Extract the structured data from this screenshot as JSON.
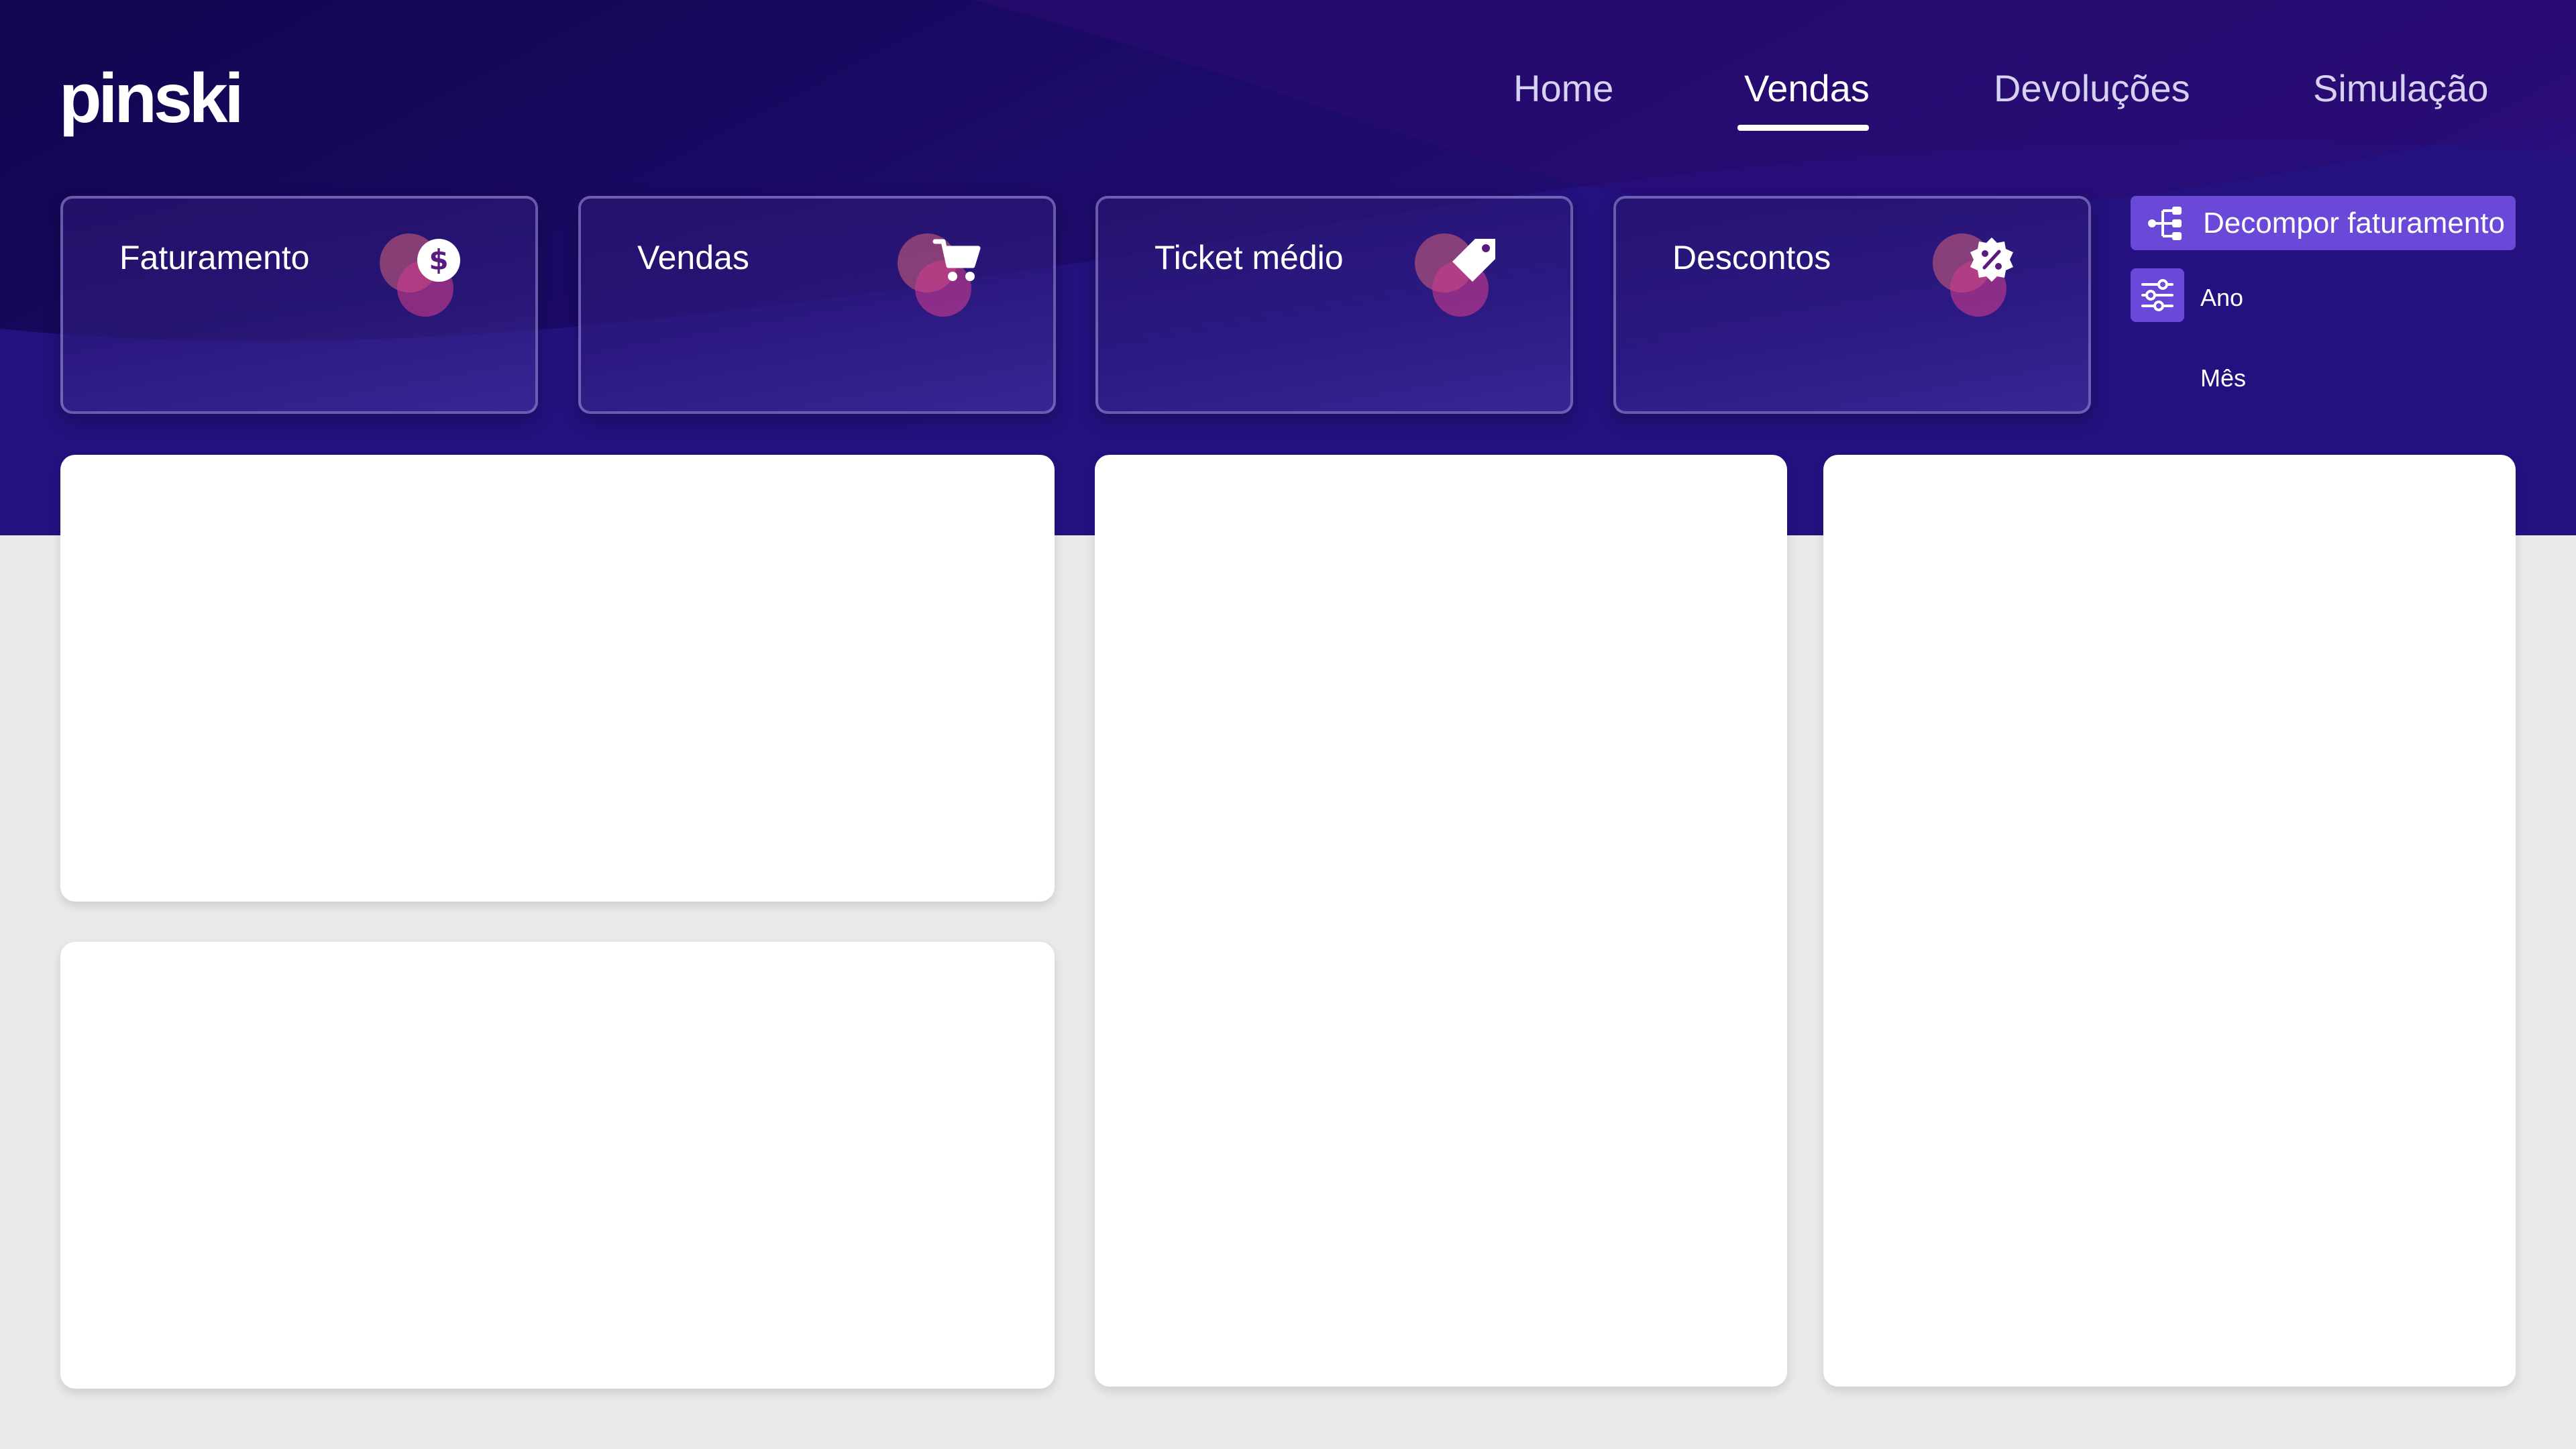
{
  "app": {
    "logo": "pinski"
  },
  "nav": {
    "items": [
      {
        "label": "Home",
        "active": false
      },
      {
        "label": "Vendas",
        "active": true
      },
      {
        "label": "Devoluções",
        "active": false
      },
      {
        "label": "Simulação",
        "active": false
      }
    ]
  },
  "kpis": [
    {
      "title": "Faturamento",
      "icon": "dollar-coin-icon"
    },
    {
      "title": "Vendas",
      "icon": "shopping-cart-icon"
    },
    {
      "title": "Ticket médio",
      "icon": "price-tag-icon"
    },
    {
      "title": "Descontos",
      "icon": "discount-badge-icon"
    }
  ],
  "sidebar": {
    "decompose_button": {
      "label": "Decompor faturamento",
      "icon": "decompose-tree-icon"
    },
    "filter_icon": "filter-sliders-icon",
    "filters": {
      "year_label": "Ano",
      "month_label": "Mês"
    }
  },
  "colors": {
    "header": "#1f0c74",
    "accent": "#6a48d8",
    "background": "#e9e9e9",
    "card": "#ffffff"
  }
}
